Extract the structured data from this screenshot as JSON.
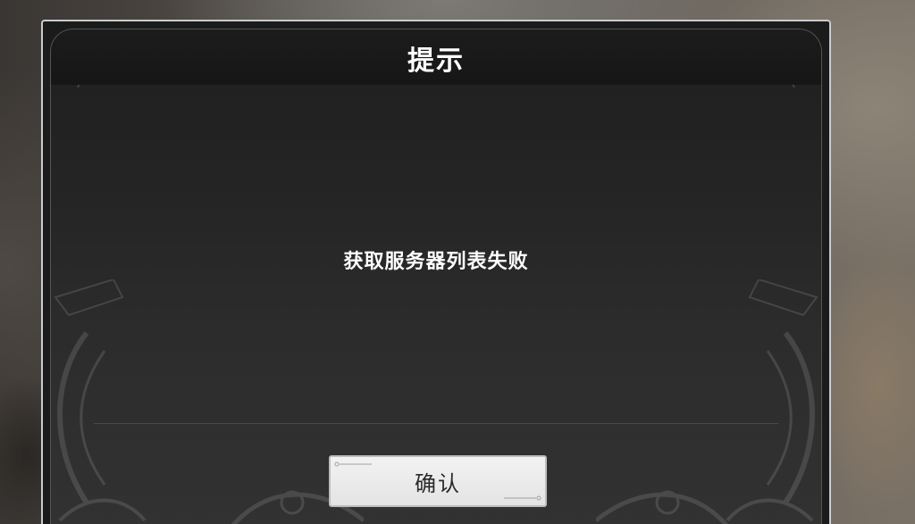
{
  "dialog": {
    "title": "提示",
    "message": "获取服务器列表失败",
    "confirm_label": "确认"
  },
  "colors": {
    "frame_border": "#c9ccd0",
    "panel_background": "#2a2a2a",
    "title_bar": "#161616",
    "text": "#ffffff",
    "button_background": "#eeeeee",
    "button_text": "#2a2a2a"
  },
  "icons": [
    "ornament-scroll-icon",
    "button-corner-deco-icon"
  ]
}
